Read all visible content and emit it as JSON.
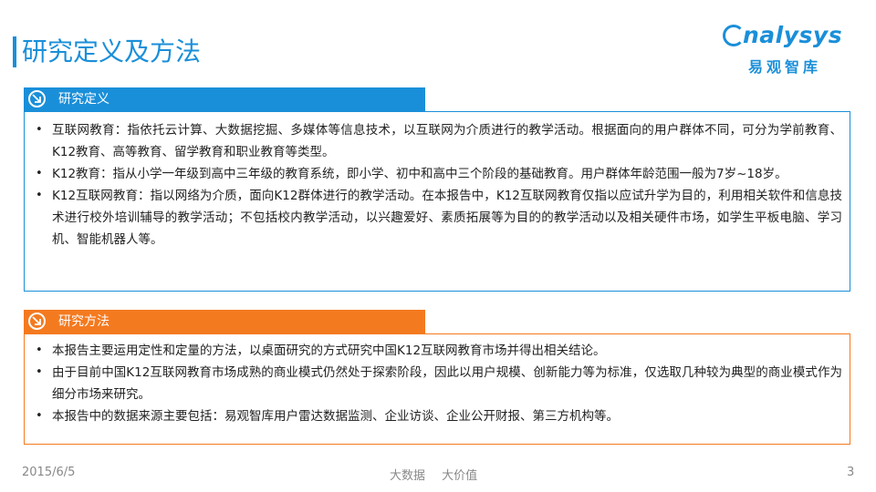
{
  "page": {
    "title": "研究定义及方法"
  },
  "logo": {
    "word": "nalysys",
    "cn": "易观智库"
  },
  "sections": [
    {
      "label": "研究定义",
      "items": [
        "互联网教育：指依托云计算、大数据挖掘、多媒体等信息技术，以互联网为介质进行的教学活动。根据面向的用户群体不同，可分为学前教育、K12教育、高等教育、留学教育和职业教育等类型。",
        "K12教育：指从小学一年级到高中三年级的教育系统，即小学、初中和高中三个阶段的基础教育。用户群体年龄范围一般为7岁~18岁。",
        "K12互联网教育：指以网络为介质，面向K12群体进行的教学活动。在本报告中，K12互联网教育仅指以应试升学为目的，利用相关软件和信息技术进行校外培训辅导的教学活动；不包括校内教学活动，以兴趣爱好、素质拓展等为目的的教学活动以及相关硬件市场，如学生平板电脑、学习机、智能机器人等。"
      ]
    },
    {
      "label": "研究方法",
      "items": [
        "本报告主要运用定性和定量的方法，以桌面研究的方式研究中国K12互联网教育市场并得出相关结论。",
        "由于目前中国K12互联网教育市场成熟的商业模式仍然处于探索阶段，因此以用户规模、创新能力等为标准，仅选取几种较为典型的商业模式作为细分市场来研究。",
        "本报告中的数据来源主要包括：易观智库用户雷达数据监测、企业访谈、企业公开财报、第三方机构等。"
      ]
    }
  ],
  "footer": {
    "date": "2015/6/5",
    "center": "大数据 大价值",
    "page": "3"
  },
  "colors": {
    "blue": "#1a8fd9",
    "orange": "#f47a20"
  },
  "icons": {
    "section": "arrow-circle-icon",
    "bullet": "•"
  }
}
